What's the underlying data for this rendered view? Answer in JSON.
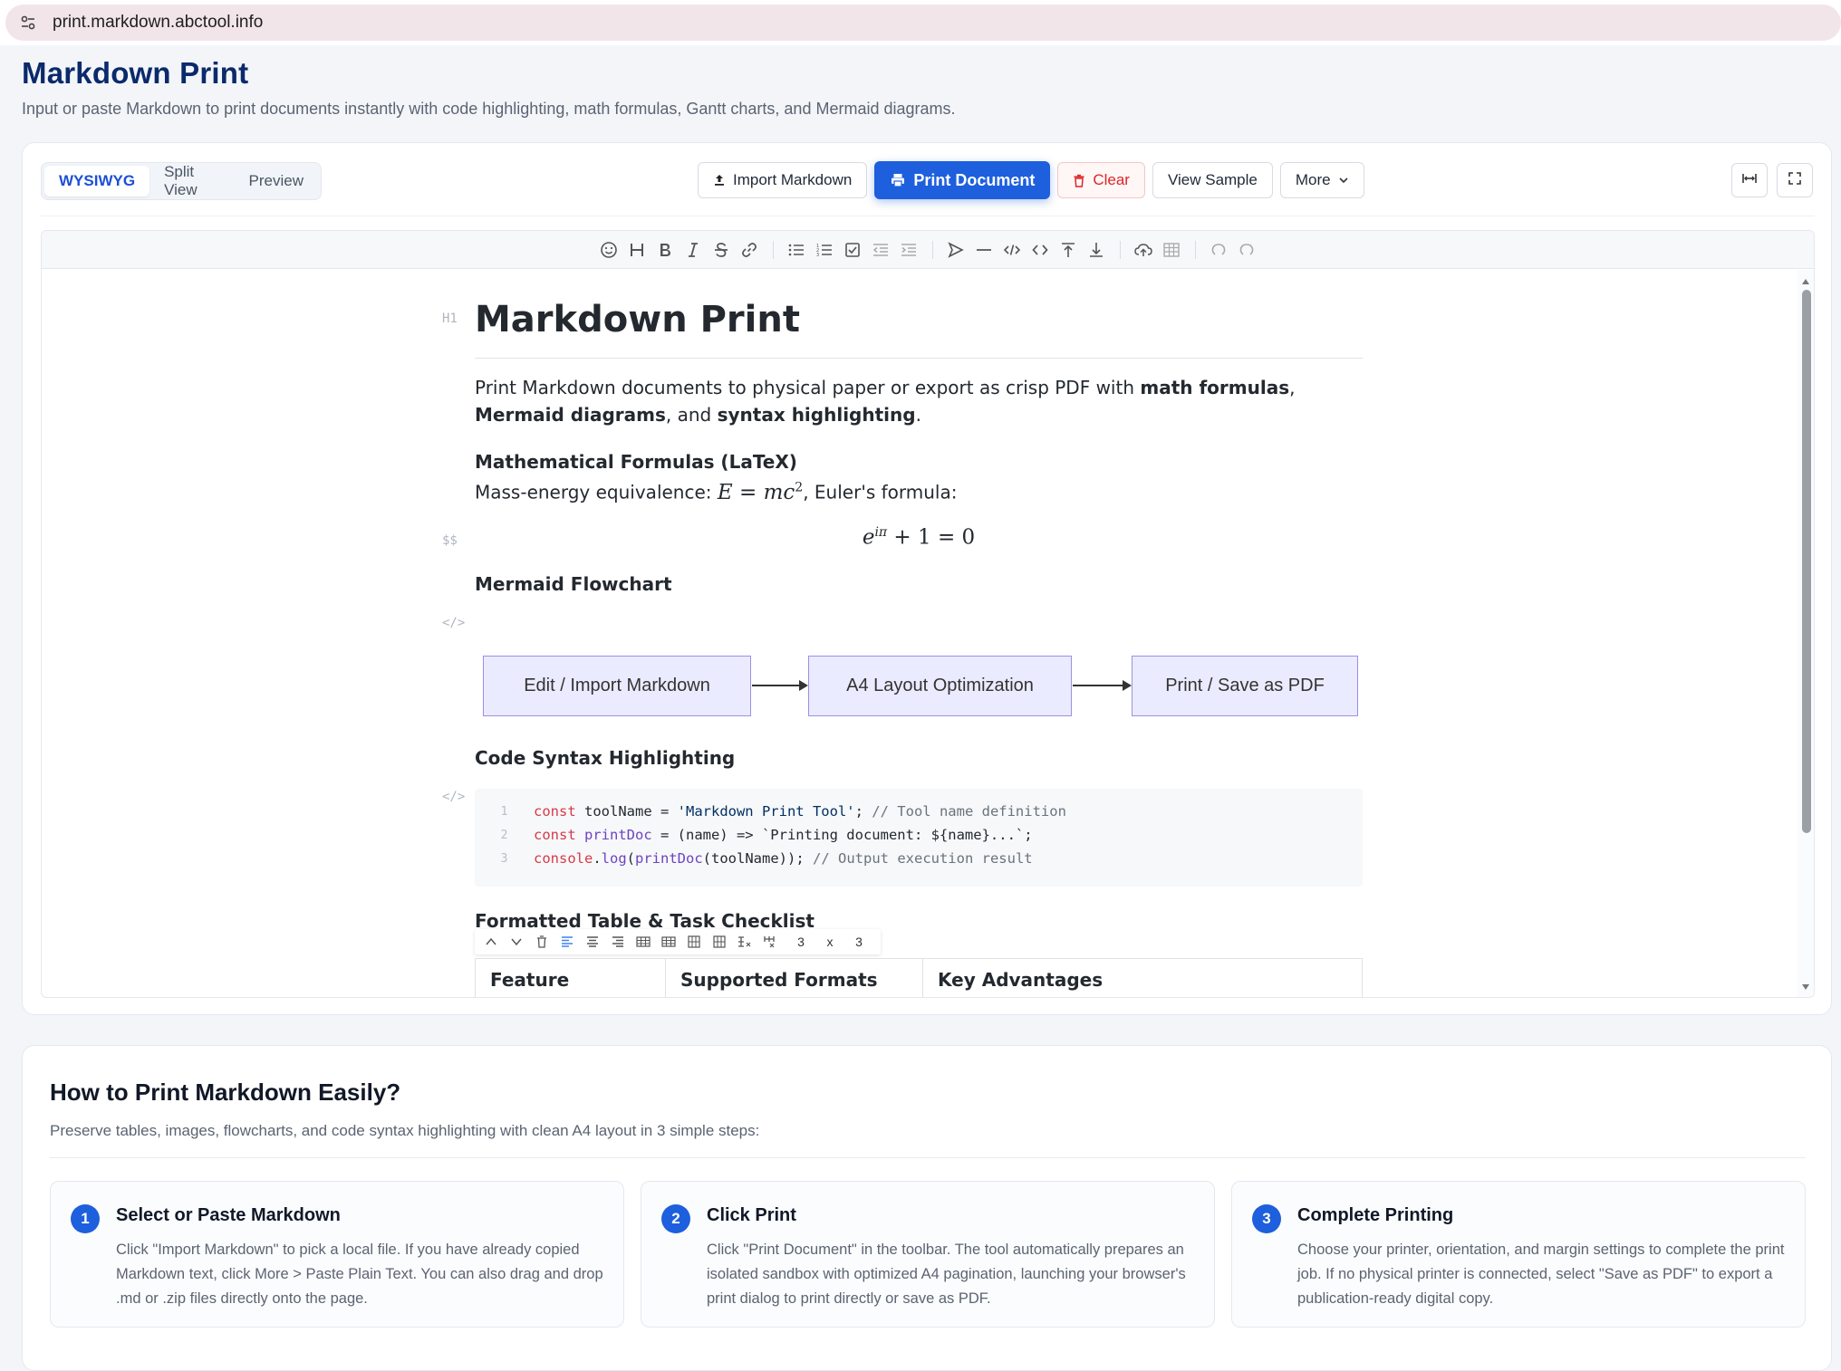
{
  "browser": {
    "url": "print.markdown.abctool.info"
  },
  "header": {
    "title": "Markdown Print",
    "subtitle": "Input or paste Markdown to print documents instantly with code highlighting, math formulas, Gantt charts, and Mermaid diagrams."
  },
  "modes": [
    "WYSIWYG",
    "Split View",
    "Preview"
  ],
  "active_mode": "WYSIWYG",
  "actions": {
    "import": "Import Markdown",
    "print": "Print Document",
    "clear": "Clear",
    "sample": "View Sample",
    "more": "More"
  },
  "colors": {
    "primary": "#1d5fdd",
    "danger": "#dc2626",
    "title": "#0b2a6b",
    "node_fill": "#ebebff",
    "node_border": "#9b8fe8"
  },
  "document": {
    "gutter": {
      "h1": "H1",
      "math": "$$",
      "code1": "</>",
      "code2": "</>"
    },
    "h1": "Markdown Print",
    "intro": {
      "t1": "Print Markdown documents to physical paper or export as crisp PDF with ",
      "b1": "math formulas",
      "t2": ",",
      "b2": "Mermaid diagrams",
      "t3": ", and ",
      "b3": "syntax highlighting",
      "t4": "."
    },
    "math_heading": "Mathematical Formulas (LaTeX)",
    "math_line": {
      "prefix": "Mass-energy equivalence: ",
      "eq_E": "E",
      "eq_eq": " = ",
      "eq_mc": "mc",
      "eq_sup": "2",
      "suffix": ", Euler's formula:"
    },
    "display_math": {
      "e": "e",
      "sup": "iπ",
      "rest": " + 1 = 0"
    },
    "flow_heading": "Mermaid Flowchart",
    "flow_nodes": [
      "Edit / Import Markdown",
      "A4 Layout Optimization",
      "Print / Save as PDF"
    ],
    "code_heading": "Code Syntax Highlighting",
    "code_lines": [
      {
        "n": "1",
        "parts": [
          [
            "kw",
            "const "
          ],
          [
            "pl",
            "toolName = "
          ],
          [
            "str",
            "'Markdown Print Tool'"
          ],
          [
            "pl",
            "; "
          ],
          [
            "cm",
            "// Tool name definition"
          ]
        ]
      },
      {
        "n": "2",
        "parts": [
          [
            "kw",
            "const "
          ],
          [
            "fn",
            "printDoc"
          ],
          [
            "pl",
            " = (name) => `Printing document: ${name}...`;"
          ]
        ]
      },
      {
        "n": "3",
        "parts": [
          [
            "kw",
            "console"
          ],
          [
            "pl",
            "."
          ],
          [
            "fn",
            "log"
          ],
          [
            "pl",
            "("
          ],
          [
            "fn",
            "printDoc"
          ],
          [
            "pl",
            "(toolName)); "
          ],
          [
            "cm",
            "// Output execution result"
          ]
        ]
      }
    ],
    "table_heading": "Formatted Table & Task Checklist",
    "table_rows_count": "3",
    "table_x": "x",
    "table_cols_count": "3",
    "table_headers": [
      "Feature",
      "Supported Formats",
      "Key Advantages"
    ]
  },
  "howto": {
    "title": "How to Print Markdown Easily?",
    "subtitle": "Preserve tables, images, flowcharts, and code syntax highlighting with clean A4 layout in 3 simple steps:",
    "steps": [
      {
        "num": "1",
        "title": "Select or Paste Markdown",
        "body": "Click \"Import Markdown\" to pick a local file. If you have already copied Markdown text, click More > Paste Plain Text. You can also drag and drop .md or .zip files directly onto the page."
      },
      {
        "num": "2",
        "title": "Click Print",
        "body": "Click \"Print Document\" in the toolbar. The tool automatically prepares an isolated sandbox with optimized A4 pagination, launching your browser's print dialog to print directly or save as PDF."
      },
      {
        "num": "3",
        "title": "Complete Printing",
        "body": "Choose your printer, orientation, and margin settings to complete the print job. If no physical printer is connected, select \"Save as PDF\" to export a publication-ready digital copy."
      }
    ]
  }
}
